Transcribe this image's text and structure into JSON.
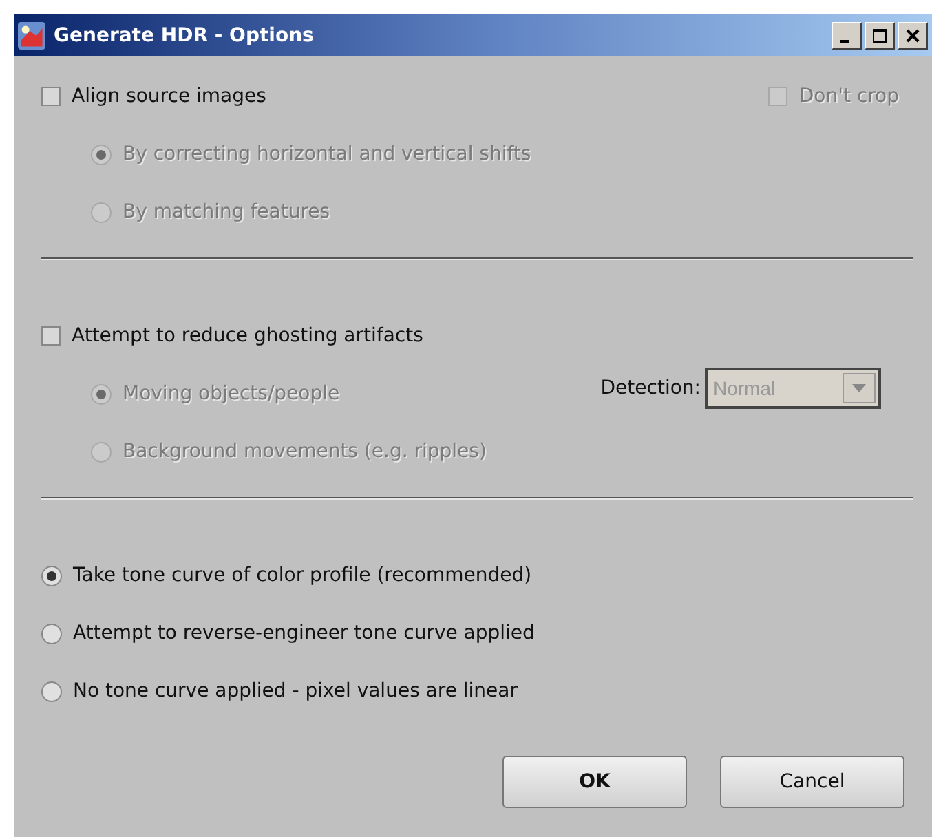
{
  "window": {
    "title": "Generate HDR - Options"
  },
  "alignment": {
    "checkbox": {
      "label": "Align source images",
      "checked": false,
      "disabled": false
    },
    "dont_crop": {
      "label": "Don't crop",
      "checked": false,
      "disabled": true
    },
    "options": [
      {
        "label": "By correcting horizontal and vertical shifts",
        "selected": true,
        "disabled": true
      },
      {
        "label": "By matching features",
        "selected": false,
        "disabled": true
      }
    ]
  },
  "ghosting": {
    "checkbox": {
      "label": "Attempt to reduce ghosting artifacts",
      "checked": false,
      "disabled": false
    },
    "detection": {
      "label": "Detection:",
      "value": "Normal",
      "disabled": true
    },
    "options": [
      {
        "label": "Moving objects/people",
        "selected": true,
        "disabled": true
      },
      {
        "label": "Background movements (e.g. ripples)",
        "selected": false,
        "disabled": true
      }
    ]
  },
  "tone_curve": {
    "options": [
      {
        "label": "Take tone curve of color profile (recommended)",
        "selected": true,
        "disabled": false
      },
      {
        "label": "Attempt to reverse-engineer tone curve applied",
        "selected": false,
        "disabled": false
      },
      {
        "label": "No tone curve applied - pixel values are linear",
        "selected": false,
        "disabled": false
      }
    ]
  },
  "buttons": [
    {
      "label": "OK",
      "default": true
    },
    {
      "label": "Cancel",
      "default": false
    }
  ]
}
